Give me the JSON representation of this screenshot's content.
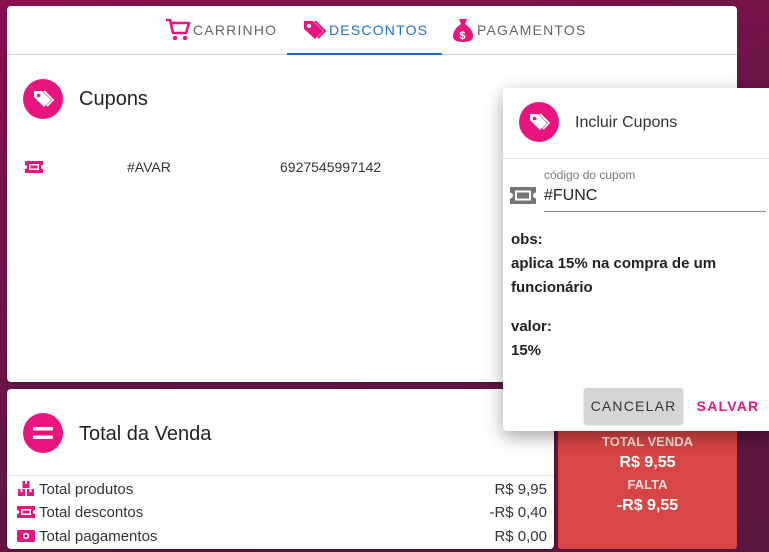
{
  "tabs": [
    {
      "label": "CARRINHO",
      "icon": "cart-icon"
    },
    {
      "label": "DESCONTOS",
      "icon": "tags-icon"
    },
    {
      "label": "PAGAMENTOS",
      "icon": "money-bag-icon"
    }
  ],
  "cupons": {
    "title": "Cupons",
    "rows": [
      {
        "icon": "ticket-icon",
        "code": "#AVAR",
        "number": "6927545997142"
      }
    ]
  },
  "total_venda": {
    "title": "Total da Venda",
    "rows": [
      {
        "label": "Total produtos",
        "value": "R$ 9,95",
        "icon": "boxes-icon"
      },
      {
        "label": "Total descontos",
        "value": "-R$ 0,40",
        "icon": "ticket-icon"
      },
      {
        "label": "Total pagamentos",
        "value": "R$ 0,00",
        "icon": "money-icon"
      }
    ]
  },
  "summary_box": {
    "total_label": "TOTAL VENDA",
    "total_value": "R$ 9,55",
    "falta_label": "FALTA",
    "falta_value": "-R$ 9,55"
  },
  "dialog": {
    "title": "Incluir Cupons",
    "code_field": {
      "label": "código do cupom",
      "value": "#FUNC"
    },
    "obs_label": "obs:",
    "obs_text_line1": "aplica 15% na compra de um",
    "obs_text_line2": "funcionário",
    "valor_label": "valor:",
    "valor_value": "15%",
    "cancel_label": "CANCELAR",
    "save_label": "SALVAR"
  },
  "colors": {
    "accent": "#e8157f",
    "active_tab": "#1e6fd0",
    "summary_red": "#d84545"
  }
}
